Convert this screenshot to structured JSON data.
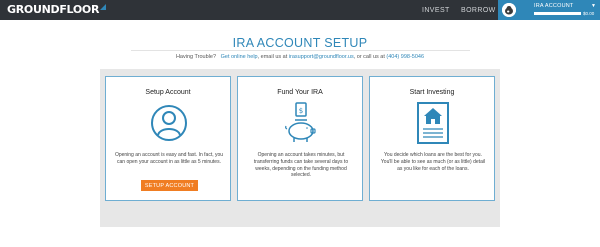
{
  "brand": {
    "name": "GROUNDFLOOR"
  },
  "nav": {
    "invest": "INVEST",
    "borrow": "BORROW"
  },
  "account": {
    "label": "IRA ACCOUNT",
    "balance": "$0.00"
  },
  "page": {
    "title": "IRA ACCOUNT SETUP",
    "help_prefix": "Having Trouble?",
    "help_link": "Get online help",
    "help_mid": ", email us at",
    "help_email": "irasupport@groundfloor.us",
    "help_call": ", or call us at",
    "help_phone": "(404) 998-5046"
  },
  "cards": [
    {
      "title": "Setup Account",
      "icon": "user-circle-icon",
      "text": "Opening an account is easy and fast. In fact, you can open your account in as little as 5 minutes.",
      "button": "SETUP ACCOUNT"
    },
    {
      "title": "Fund Your IRA",
      "icon": "piggy-bank-icon",
      "text": "Opening an account takes minutes, but transferring funds can take several days to weeks, depending on the funding method selected."
    },
    {
      "title": "Start Investing",
      "icon": "house-document-icon",
      "text": "You decide which loans are the best for you. You'll be able to see as much (or as little) detail as you like for each of the loans."
    }
  ],
  "colors": {
    "topbar": "#2f3338",
    "accent": "#2f87b8",
    "button": "#f07d22",
    "panel": "#e7e7e7"
  }
}
